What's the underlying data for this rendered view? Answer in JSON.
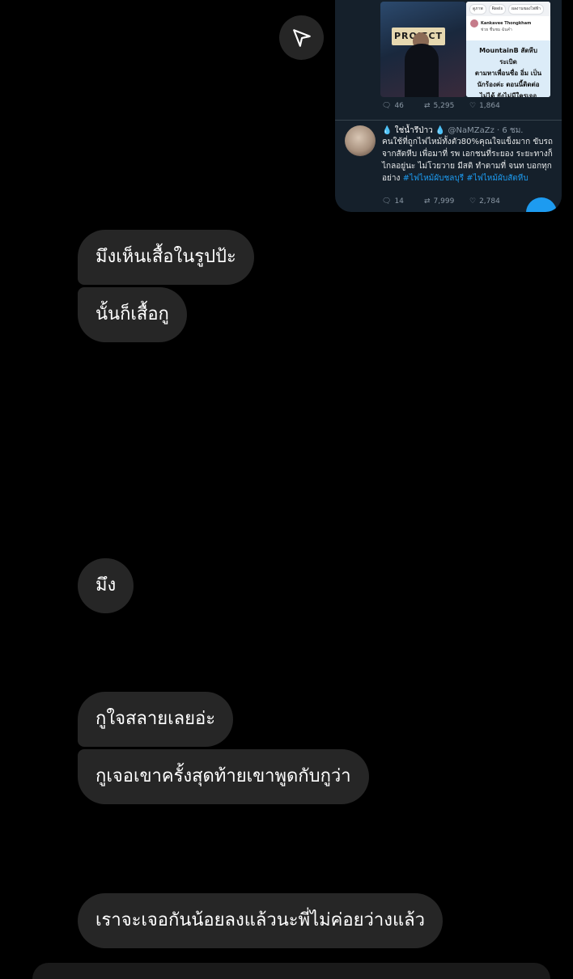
{
  "shared_post": {
    "photo_sign": "PROJECT",
    "fb_chips": [
      "ดูภาพ",
      "Reels",
      "ผลงานของไฟฟ้า"
    ],
    "fb_author": "Kankavee Thongkham",
    "fb_sub": "ช่วย ชื่นชม ฉันคำ",
    "fb_headline": "MountainB สัตหีบ",
    "fb_body_1": "ระเบิด",
    "fb_body_2": "ตามหาเพื่อนชื่อ อิ่ม เป็น",
    "fb_body_3": "นักร้องค่ะ ตอนนี้ติดต่อ",
    "fb_body_4": "ไม่ได้ ยังไม่มีใครเจอ",
    "stats": {
      "replies": "46",
      "retweets": "5,295",
      "likes": "1,864"
    },
    "tweet": {
      "name": "💧 ใช่น้ำรึป่าว 💧",
      "handle": "@NaMZaZz · 6 ชม.",
      "text": "คนใช้ที่ถูกไฟไหม้ทั้งตัว80%คุณใจแข็งมาก ขับรถจากสัตหีบ เพื่อมาที่ รพ เอกชนที่ระยอง ระยะทางก็ไกลอยู่นะ ไม่โวยวาย มีสติ ทำตามที่ จนท บอกทุกอย่าง",
      "hashtags": "#ไฟไหม้ผับชลบุรี #ไฟไหม้ผับสัตหีบ",
      "stats": {
        "replies": "14",
        "retweets": "7,999",
        "likes": "2,784"
      }
    }
  },
  "messages": [
    "มึงเห็นเสื้อในรูปป้ะ",
    "นั้นก็เสื้อกู",
    "มึง",
    "กูใจสลายเลยอ่ะ",
    "กูเจอเขาครั้งสุดท้ายเขาพูดกับกูว่า",
    "เราจะเจอกันน้อยลงแล้วนะพี่ไม่ค่อยว่างแล้ว"
  ],
  "colors": {
    "background": "#000000",
    "bubble": "#262626",
    "twitter_bg": "#15202b",
    "twitter_blue": "#1d9bf0"
  }
}
